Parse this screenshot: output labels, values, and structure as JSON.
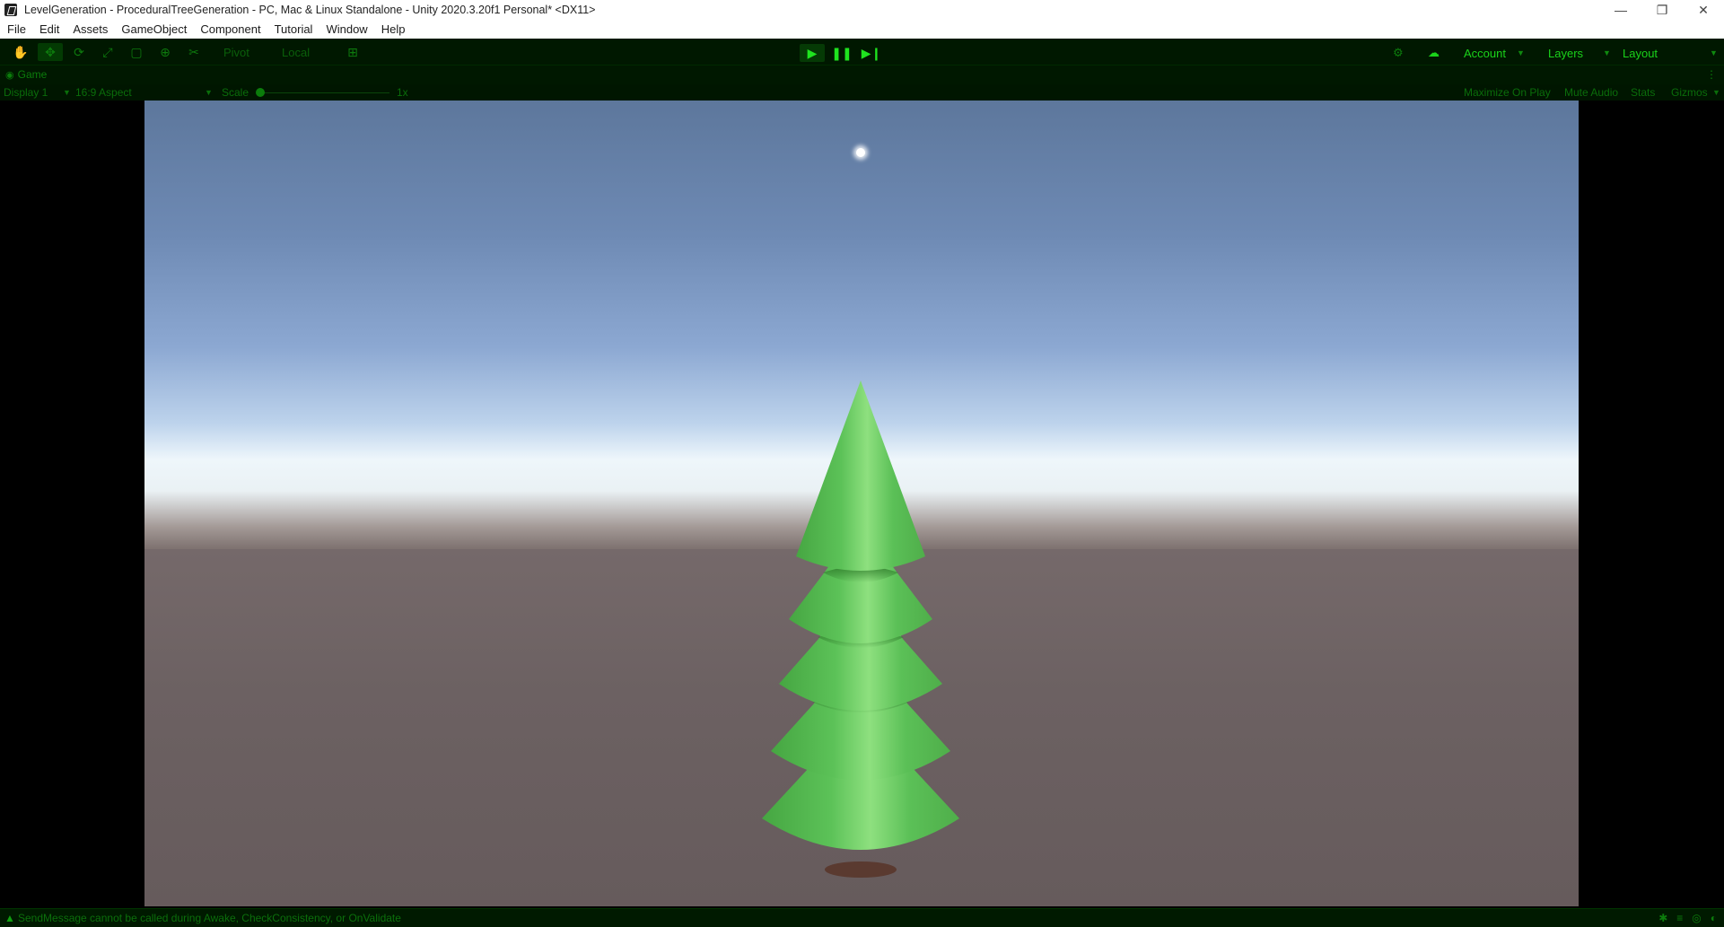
{
  "window": {
    "title": "LevelGeneration - ProceduralTreeGeneration - PC, Mac & Linux Standalone - Unity 2020.3.20f1 Personal* <DX11>",
    "minimize": "—",
    "restore": "❐",
    "close": "✕"
  },
  "menu": [
    "File",
    "Edit",
    "Assets",
    "GameObject",
    "Component",
    "Tutorial",
    "Window",
    "Help"
  ],
  "toolbar": {
    "pivot": "Pivot",
    "local": "Local",
    "account": "Account",
    "layers": "Layers",
    "layout": "Layout"
  },
  "tab": {
    "label": "Game"
  },
  "gamebar": {
    "display": "Display 1",
    "aspect": "16:9 Aspect",
    "scale_label": "Scale",
    "scale_value": "1x",
    "maximize": "Maximize On Play",
    "mute": "Mute Audio",
    "stats": "Stats",
    "gizmos": "Gizmos"
  },
  "status": {
    "message": "SendMessage cannot be called during Awake, CheckConsistency, or OnValidate"
  },
  "colors": {
    "tree_green": "#5fc35a",
    "ui_green": "#1ad21a"
  }
}
